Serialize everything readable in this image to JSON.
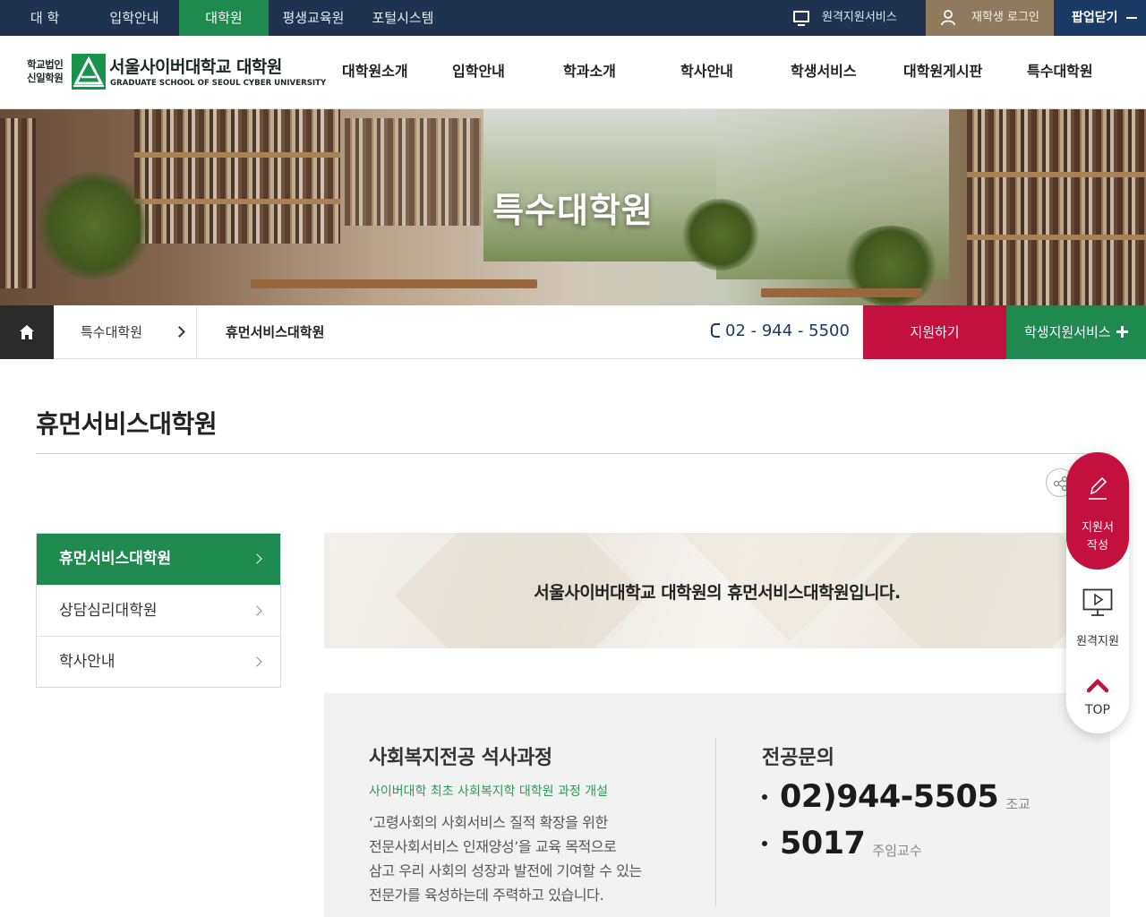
{
  "topbar": {
    "links": [
      "대 학",
      "입학안내",
      "대학원",
      "평생교육원",
      "포털시스템"
    ],
    "active_link": "대학원",
    "remote_service": "원격지원서비스",
    "student_login": "재학생 로그인",
    "popup_close": "팝업닫기"
  },
  "header": {
    "logo_corp_line1": "학교법인",
    "logo_corp_line2": "신일학원",
    "logo_name": "서울사이버대학교 대학원",
    "logo_eng": "GRADUATE SCHOOL OF SEOUL CYBER UNIVERSITY",
    "nav": [
      "대학원소개",
      "입학안내",
      "학과소개",
      "학사안내",
      "학생서비스",
      "대학원게시판",
      "특수대학원"
    ]
  },
  "hero": {
    "title": "특수대학원"
  },
  "breadcrumb": {
    "level1": "특수대학원",
    "level2": "휴먼서비스대학원",
    "phone": "02 - 944 - 5500",
    "apply_button": "지원하기",
    "service_button": "학생지원서비스"
  },
  "page": {
    "title": "휴먼서비스대학원"
  },
  "lnb": {
    "items": [
      "휴먼서비스대학원",
      "상담심리대학원",
      "학사안내"
    ],
    "active_index": 0
  },
  "intro": {
    "text": "서울사이버대학교 대학원의 휴먼서비스대학원입니다."
  },
  "program": {
    "heading": "사회복지전공 석사과정",
    "subheading": "사이버대학 최초 사회복지학 대학원 과정 개설",
    "description_lines": [
      "‘고령사회의 사회서비스 질적 확장을 위한",
      "전문사회서비스 인재양성’을 교육 목적으로",
      "삼고 우리 사회의 성장과 발전에 기여할 수 있는",
      "전문가를 육성하는데 주력하고 있습니다."
    ]
  },
  "contact": {
    "heading": "전공문의",
    "items": [
      {
        "number": "02)944-5505",
        "role": "조교"
      },
      {
        "number": "5017",
        "role": "주임교수"
      }
    ]
  },
  "quick_menu": {
    "apply_line1": "지원서",
    "apply_line2": "작성",
    "remote": "원격지원",
    "top": "TOP"
  },
  "colors": {
    "topbar_bg": "#1f3350",
    "brand_green": "#1e8a4f",
    "accent_red": "#c4103f",
    "login_bg": "#8e7a5d",
    "navy": "#1a3a66"
  }
}
